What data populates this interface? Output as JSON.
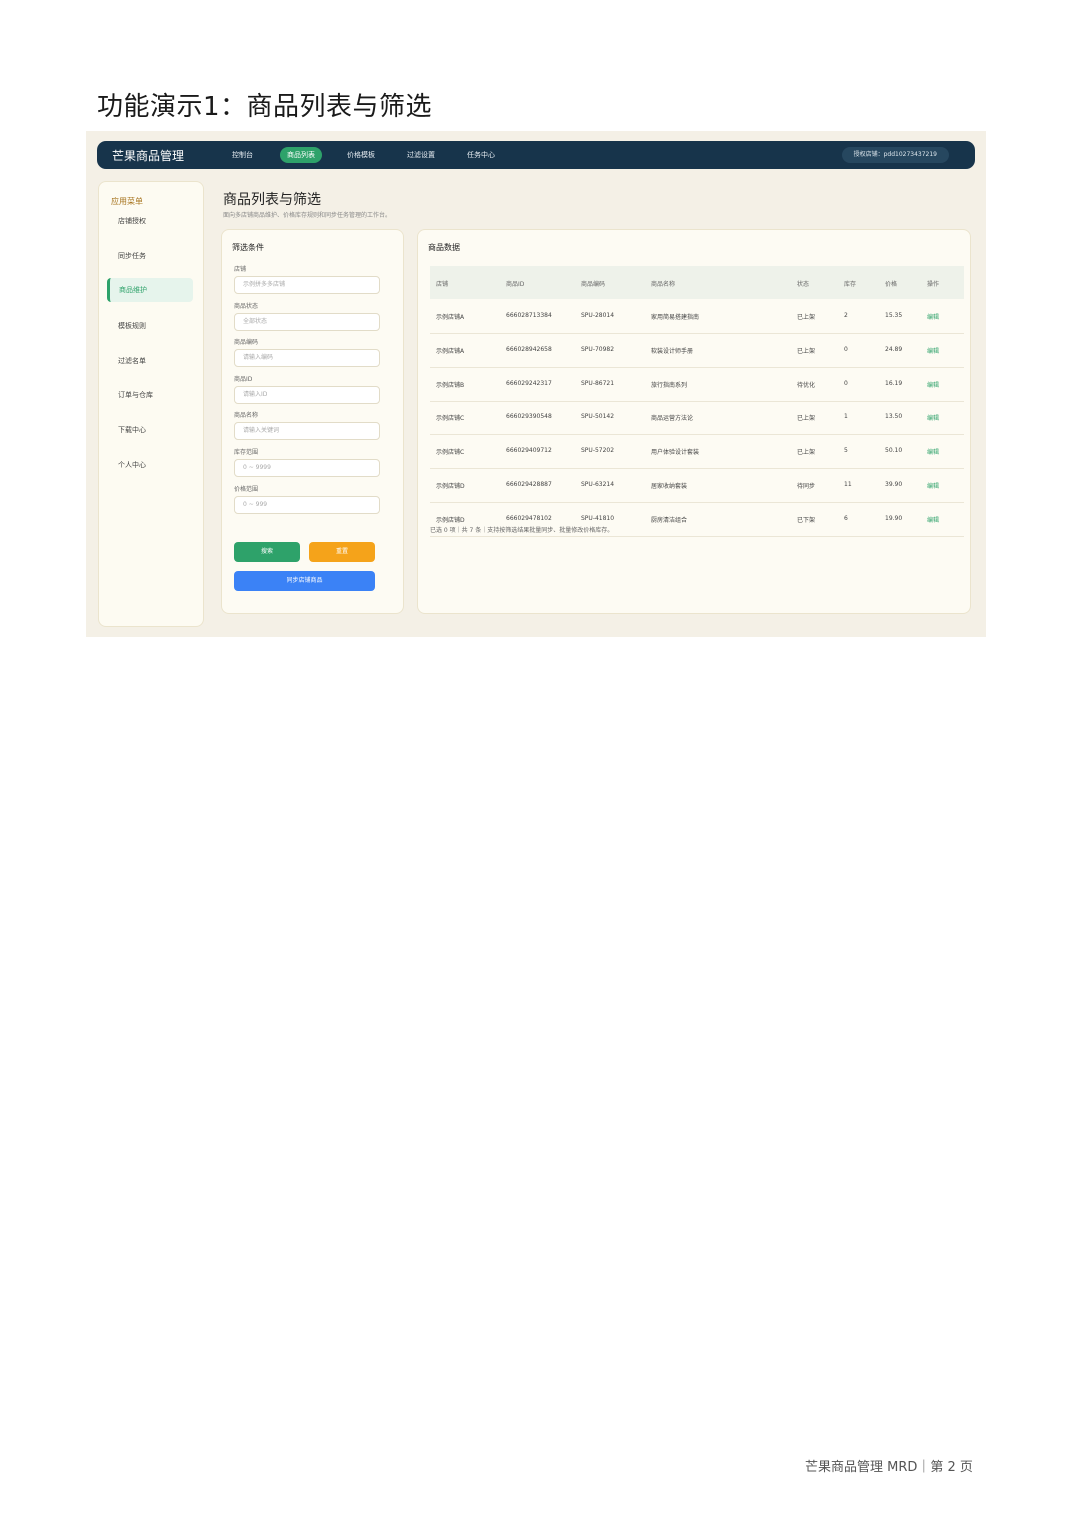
{
  "doc_title": "功能演示1：商品列表与筛选",
  "app": {
    "brand": "芒果商品管理",
    "nav": [
      "控制台",
      "商品列表",
      "价格模板",
      "过滤设置",
      "任务中心"
    ],
    "nav_active_index": 1,
    "auth_store": "授权店铺：pdd10273437219"
  },
  "sidebar": {
    "heading": "应用菜单",
    "items": [
      "店铺授权",
      "同步任务",
      "商品维护",
      "模板规则",
      "过滤名单",
      "订单与仓库",
      "下载中心",
      "个人中心"
    ],
    "active_index": 2
  },
  "page": {
    "title": "商品列表与筛选",
    "subtitle": "面向多店铺商品维护、价格库存规则和同步任务管理的工作台。"
  },
  "filter": {
    "title": "筛选条件",
    "fields": [
      {
        "label": "店铺",
        "placeholder": "示例拼多多店铺"
      },
      {
        "label": "商品状态",
        "placeholder": "全部状态"
      },
      {
        "label": "商品编码",
        "placeholder": "请输入编码"
      },
      {
        "label": "商品ID",
        "placeholder": "请输入ID"
      },
      {
        "label": "商品名称",
        "placeholder": "请输入关键词"
      },
      {
        "label": "库存范围",
        "placeholder": "0 ~ 9999"
      },
      {
        "label": "价格范围",
        "placeholder": "0 ~ 999"
      }
    ],
    "search_button": "搜索",
    "reset_button": "重置",
    "sync_button": "同步店铺商品",
    "colors": {
      "search": "#2ea26a",
      "reset": "#f5a31a",
      "sync": "#3b82f6"
    }
  },
  "table": {
    "title": "商品数据",
    "headers": [
      "店铺",
      "商品ID",
      "商品编码",
      "商品名称",
      "状态",
      "库存",
      "价格",
      "操作"
    ],
    "rows": [
      [
        "示例店铺A",
        "666028713384",
        "SPU-28014",
        "家用简易搭建指南",
        "已上架",
        "2",
        "15.35",
        "编辑"
      ],
      [
        "示例店铺A",
        "666028942658",
        "SPU-70982",
        "软装设计师手册",
        "已上架",
        "0",
        "24.89",
        "编辑"
      ],
      [
        "示例店铺B",
        "666029242317",
        "SPU-86721",
        "旅行指南系列",
        "待优化",
        "0",
        "16.19",
        "编辑"
      ],
      [
        "示例店铺C",
        "666029390548",
        "SPU-50142",
        "商品运营方法论",
        "已上架",
        "1",
        "13.50",
        "编辑"
      ],
      [
        "示例店铺C",
        "666029409712",
        "SPU-57202",
        "用户体验设计套装",
        "已上架",
        "5",
        "50.10",
        "编辑"
      ],
      [
        "示例店铺D",
        "666029428887",
        "SPU-63214",
        "居家收纳套装",
        "待同步",
        "11",
        "39.90",
        "编辑"
      ],
      [
        "示例店铺D",
        "666029478102",
        "SPU-41810",
        "厨房清洁组合",
        "已下架",
        "6",
        "19.90",
        "编辑"
      ]
    ],
    "footer": "已选 0 项｜共 7 条｜支持按筛选结果批量同步、批量修改价格库存。"
  },
  "page_footer": "芒果商品管理 MRD｜第 2 页"
}
